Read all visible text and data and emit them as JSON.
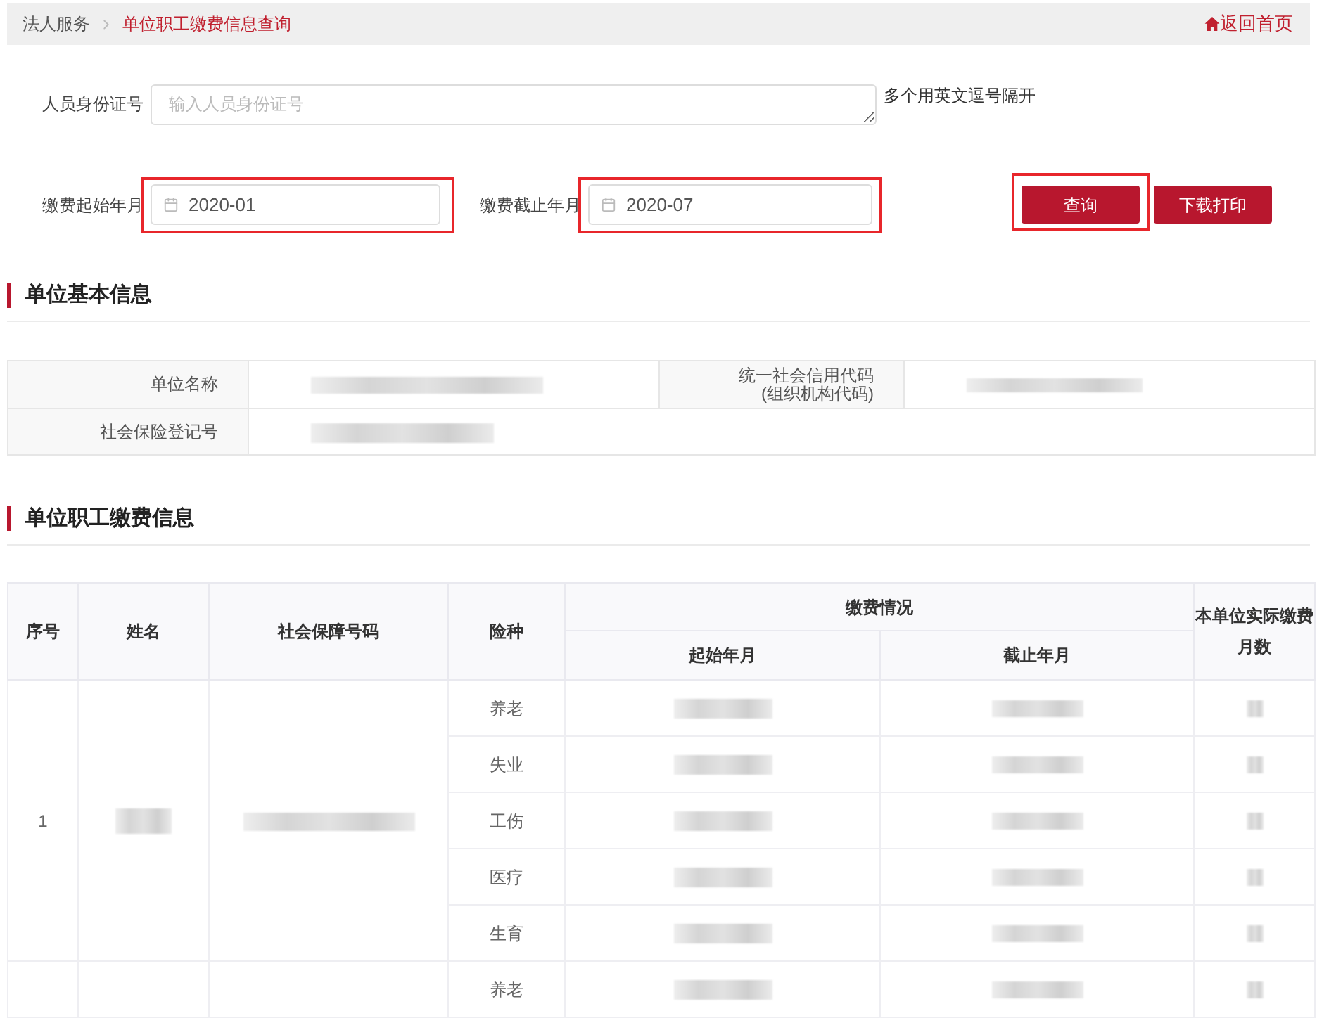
{
  "breadcrumb": {
    "items": [
      {
        "label": "法人服务",
        "current": false
      },
      {
        "label": "单位职工缴费信息查询",
        "current": true
      }
    ],
    "home_link": "返回首页"
  },
  "query_form": {
    "id_field": {
      "label": "人员身份证号",
      "placeholder": "输入人员身份证号",
      "hint": "多个用英文逗号隔开"
    },
    "date_fields": [
      {
        "label": "缴费起始年月",
        "value": "2020-01",
        "highlighted": true
      },
      {
        "label": "缴费截止年月",
        "value": "2020-07",
        "highlighted": true
      }
    ],
    "buttons": [
      {
        "label": "查询",
        "highlighted": true
      },
      {
        "label": "下载打印",
        "highlighted": false
      }
    ]
  },
  "basic_info": {
    "title": "单位基本信息",
    "rows": [
      [
        {
          "kind": "label",
          "lines": [
            "单位名称"
          ]
        },
        {
          "kind": "redacted"
        },
        {
          "kind": "label",
          "lines": [
            "统一社会信用代码",
            "(组织机构代码)"
          ]
        },
        {
          "kind": "redacted"
        }
      ],
      [
        {
          "kind": "label",
          "lines": [
            "社会保险登记号"
          ]
        },
        {
          "kind": "redacted"
        }
      ]
    ]
  },
  "payments": {
    "title": "单位职工缴费信息",
    "columns": [
      {
        "label": "序号"
      },
      {
        "label": "姓名"
      },
      {
        "label": "社会保障号码"
      },
      {
        "label": "险种"
      },
      {
        "label": "缴费情况",
        "children": [
          {
            "label": "起始年月"
          },
          {
            "label": "截止年月"
          }
        ]
      },
      {
        "label": "本单位实际缴费月数"
      }
    ],
    "persons": [
      {
        "index": "1",
        "name_redacted": true,
        "ssn_redacted": true,
        "insurances": [
          {
            "type": "养老",
            "start_redacted": true,
            "end_redacted": true,
            "months_redacted": true
          },
          {
            "type": "失业",
            "start_redacted": true,
            "end_redacted": true,
            "months_redacted": true
          },
          {
            "type": "工伤",
            "start_redacted": true,
            "end_redacted": true,
            "months_redacted": true
          },
          {
            "type": "医疗",
            "start_redacted": true,
            "end_redacted": true,
            "months_redacted": true
          },
          {
            "type": "生育",
            "start_redacted": true,
            "end_redacted": true,
            "months_redacted": true
          }
        ]
      },
      {
        "insurances": [
          {
            "type": "养老",
            "start_redacted": true,
            "end_redacted": true,
            "months_redacted": true
          }
        ]
      }
    ]
  }
}
